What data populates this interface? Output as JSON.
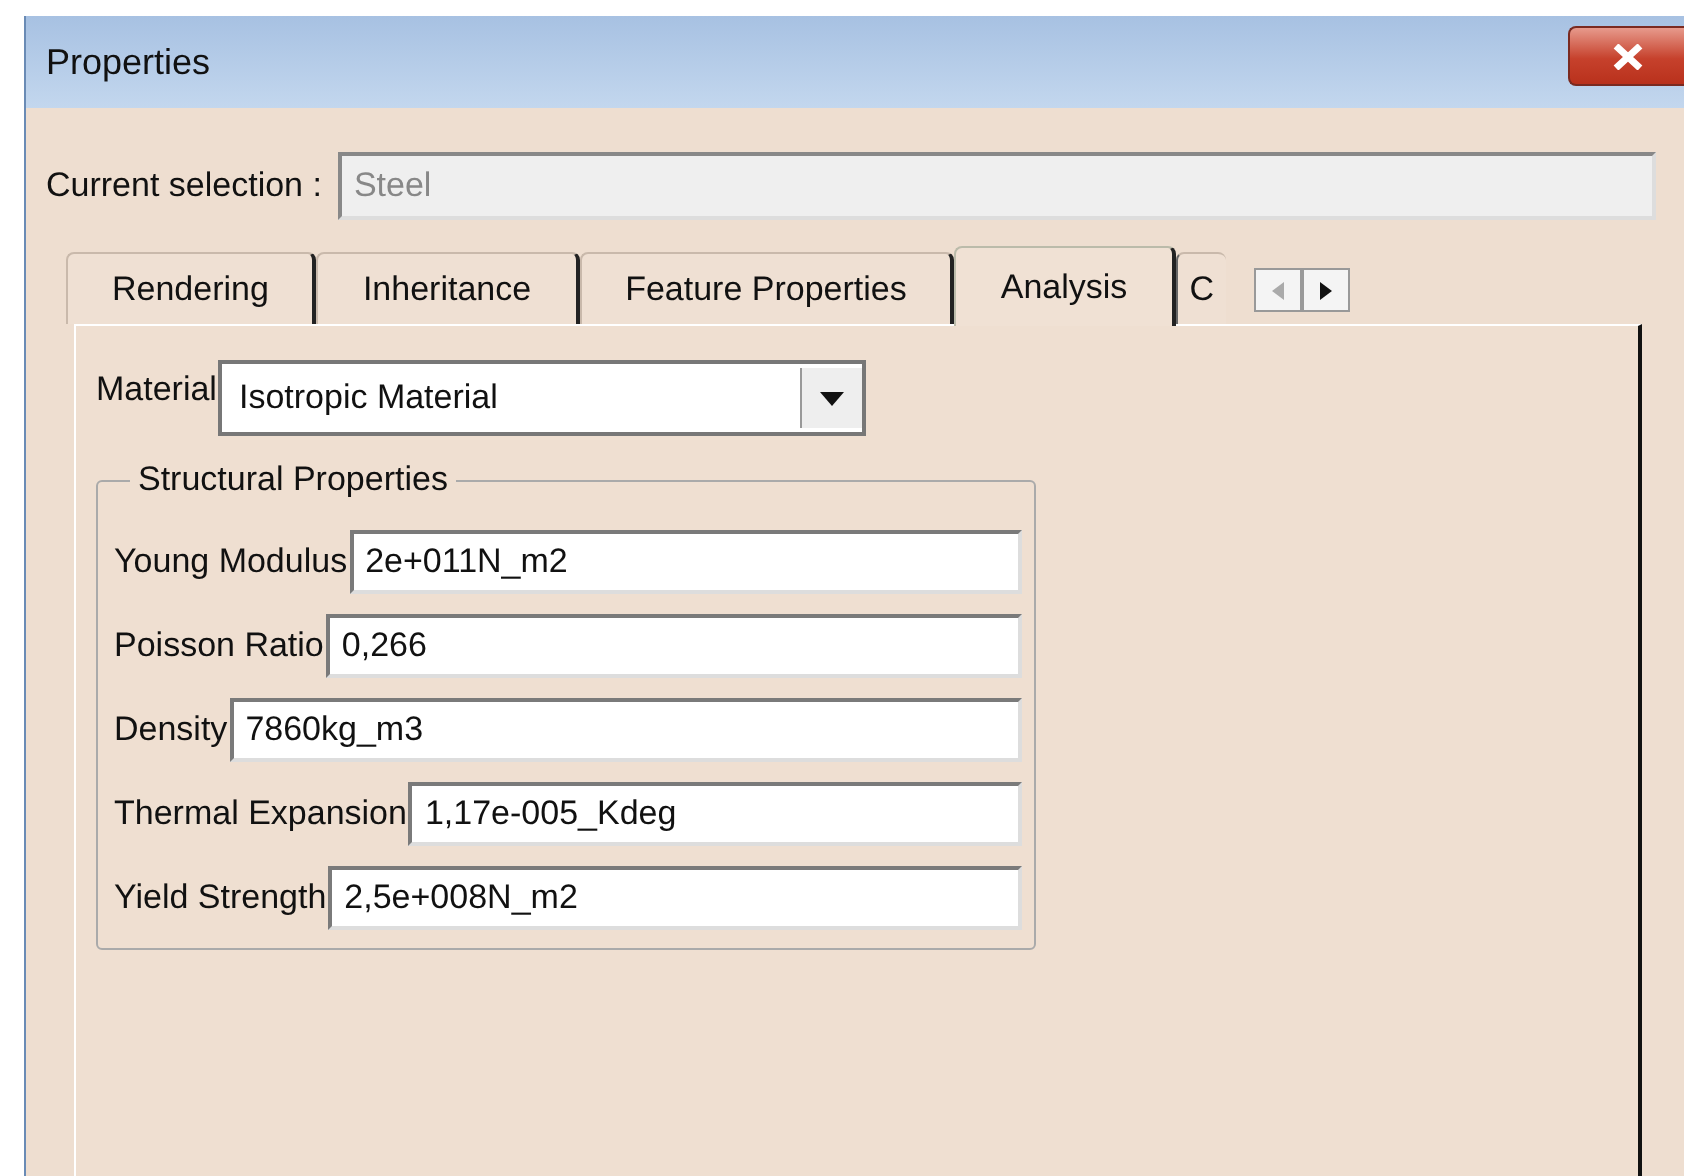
{
  "window": {
    "title": "Properties"
  },
  "current_selection": {
    "label": "Current selection :",
    "value": "Steel"
  },
  "tabs": [
    {
      "label": "Rendering",
      "selected": false
    },
    {
      "label": "Inheritance",
      "selected": false
    },
    {
      "label": "Feature Properties",
      "selected": false
    },
    {
      "label": "Analysis",
      "selected": true
    },
    {
      "label": "C",
      "selected": false
    }
  ],
  "material": {
    "label": "Material",
    "value": "Isotropic Material"
  },
  "structural_properties": {
    "title": "Structural Properties",
    "fields": [
      {
        "label": "Young Modulus",
        "value": "2e+011N_m2"
      },
      {
        "label": "Poisson Ratio",
        "value": "0,266"
      },
      {
        "label": "Density",
        "value": "7860kg_m3"
      },
      {
        "label": "Thermal Expansion",
        "value": "1,17e-005_Kdeg"
      },
      {
        "label": "Yield Strength",
        "value": "2,5e+008N_m2"
      }
    ]
  }
}
